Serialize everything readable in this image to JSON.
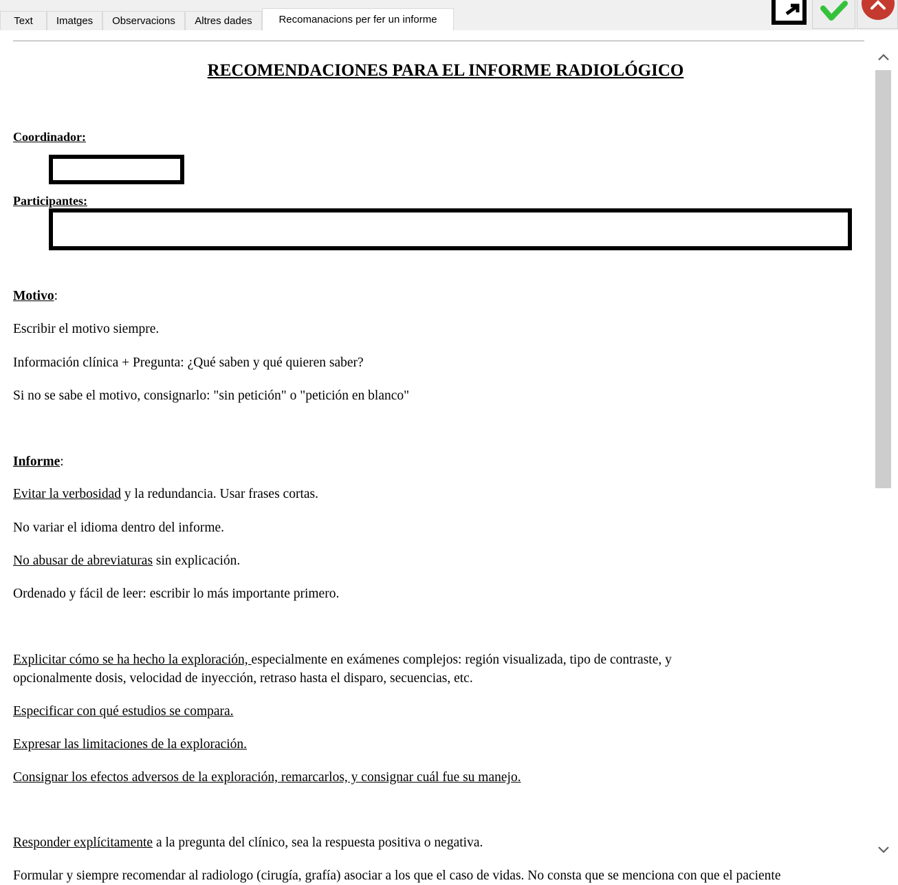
{
  "tabs": [
    {
      "label": "Text",
      "active": false
    },
    {
      "label": "Imatges",
      "active": false
    },
    {
      "label": "Observacions",
      "active": false
    },
    {
      "label": "Altres dades",
      "active": false
    },
    {
      "label": "Recomanacions per fer un informe",
      "active": true
    }
  ],
  "toolbar": {
    "icons": [
      "edit-icon",
      "checkmark-icon",
      "close-icon"
    ],
    "colors": {
      "accept": "#2ecc40",
      "close": "#c0392b"
    }
  },
  "document": {
    "title": "RECOMENDACIONES PARA EL INFORME RADIOLÓGICO",
    "coordinador_label": "Coordinador:",
    "participantes_label": "Participantes:",
    "motivo_heading": "Motivo",
    "motivo_colon": ":",
    "motivo_lines": [
      "Escribir el motivo siempre.",
      "Información clínica + Pregunta: ¿Qué saben y qué quieren saber?",
      "Si no se sabe el motivo, consignarlo: \"sin petición\" o \"petición en blanco\""
    ],
    "informe_heading": "Informe",
    "informe_colon": ":",
    "informe_items": [
      {
        "u": "Evitar la verbosidad",
        "rest": " y la redundancia. Usar frases cortas."
      },
      {
        "u": "",
        "rest": "No variar el idioma dentro del informe."
      },
      {
        "u": "No abusar de abreviaturas",
        "rest": " sin explicación."
      },
      {
        "u": "",
        "rest": "Ordenado y fácil de leer: escribir lo más importante primero."
      },
      {
        "u": "Explicitar cómo se ha hecho la exploración, ",
        "rest": "especialmente en exámenes complejos: región visualizada, tipo de contraste, y"
      },
      {
        "u": "",
        "rest": "opcionalmente dosis, velocidad de inyección, retraso hasta el disparo, secuencias, etc."
      },
      {
        "u": "Especificar con qué estudios se compara.",
        "rest": ""
      },
      {
        "u": "Expresar las limitaciones de la exploración.",
        "rest": ""
      },
      {
        "u": "Consignar los efectos adversos de la exploración, remarcarlos, y consignar cuál fue su manejo.",
        "rest": ""
      },
      {
        "u": "Responder explícitamente",
        "rest": " a la pregunta del clínico, sea la respuesta positiva o negativa."
      }
    ],
    "cutoff_line": "Formular y siempre recomendar al radiologo (cirugía, grafía) asociar a los que el caso de vidas. No consta que se menciona con que el paciente"
  },
  "scrollbar": {
    "up_icon": "chevron-up-icon",
    "down_icon": "chevron-down-icon"
  }
}
